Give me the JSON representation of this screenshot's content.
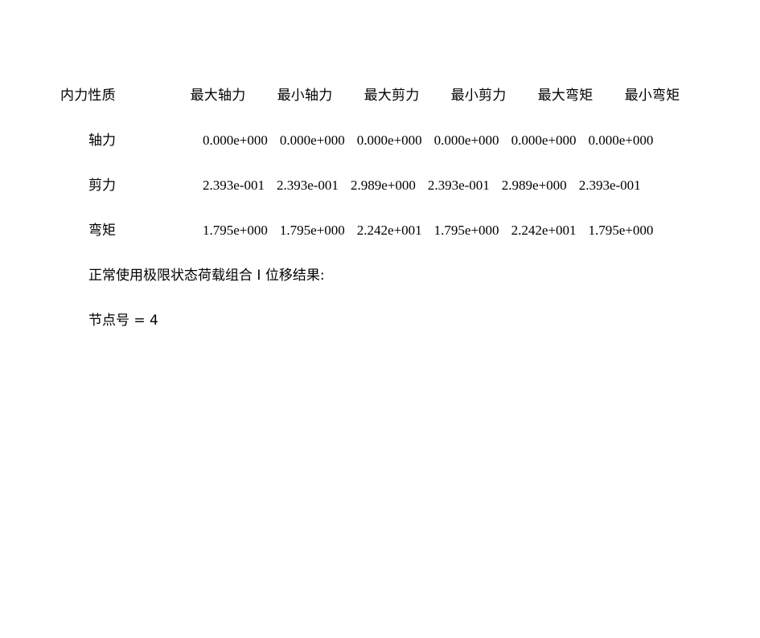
{
  "document": {
    "table": {
      "headers": [
        "内力性质",
        "最大轴力",
        "最小轴力",
        "最大剪力",
        "最小剪力",
        "最大弯矩",
        "最小弯矩"
      ],
      "rows": [
        {
          "label": "轴力",
          "values": [
            "0.000e+000",
            "0.000e+000",
            "0.000e+000",
            "0.000e+000",
            "0.000e+000",
            "0.000e+000"
          ]
        },
        {
          "label": "剪力",
          "values": [
            "2.393e-001",
            "2.393e-001",
            "2.989e+000",
            "2.393e-001",
            "2.989e+000",
            "2.393e-001"
          ]
        },
        {
          "label": "弯矩",
          "values": [
            "1.795e+000",
            "1.795e+000",
            "2.242e+001",
            "1.795e+000",
            "2.242e+001",
            "1.795e+000"
          ]
        }
      ]
    },
    "section_heading": "正常使用极限状态荷载组合 I 位移结果:",
    "node_line": "节点号  =  4"
  }
}
